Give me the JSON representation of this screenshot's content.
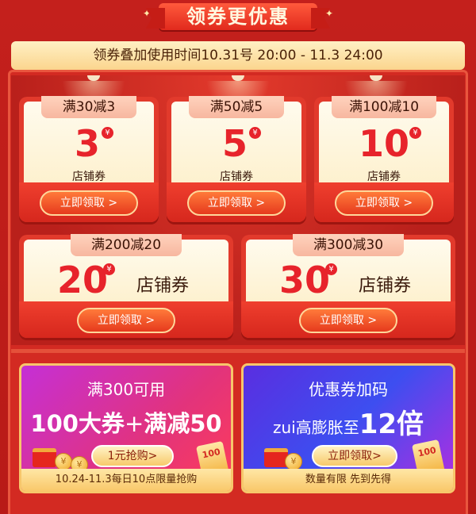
{
  "header": {
    "title": "领券更优惠",
    "banner": "领券叠加使用时间10.31号 20:00 - 11.3 24:00"
  },
  "coupons_row1": [
    {
      "tag": "满30减3",
      "amount": "3",
      "unit": "¥",
      "label": "店铺券",
      "button": "立即领取 >"
    },
    {
      "tag": "满50减5",
      "amount": "5",
      "unit": "¥",
      "label": "店铺券",
      "button": "立即领取 >"
    },
    {
      "tag": "满100减10",
      "amount": "10",
      "unit": "¥",
      "label": "店铺券",
      "button": "立即领取 >"
    }
  ],
  "coupons_row2": [
    {
      "tag": "满200减20",
      "amount": "20",
      "unit": "¥",
      "label": "店铺券",
      "button": "立即领取 >"
    },
    {
      "tag": "满300减30",
      "amount": "30",
      "unit": "¥",
      "label": "店铺券",
      "button": "立即领取 >"
    }
  ],
  "promo_left": {
    "head": "满300可用",
    "big_a": "100大券",
    "plus": "+",
    "big_b": "满减50",
    "button": "1元抢购>",
    "footer": "10.24-11.3每日10点限量抢购",
    "ticket_text": "100"
  },
  "promo_right": {
    "head": "优惠券加码",
    "big_a": "zui高膨胀至",
    "big_b": "12倍",
    "button": "立即领取>",
    "footer": "数量有限 先到先得",
    "ticket_text": "100"
  },
  "colors": {
    "accent_red": "#e7232b",
    "background": "#c4201c",
    "gold": "#f7c66b"
  }
}
